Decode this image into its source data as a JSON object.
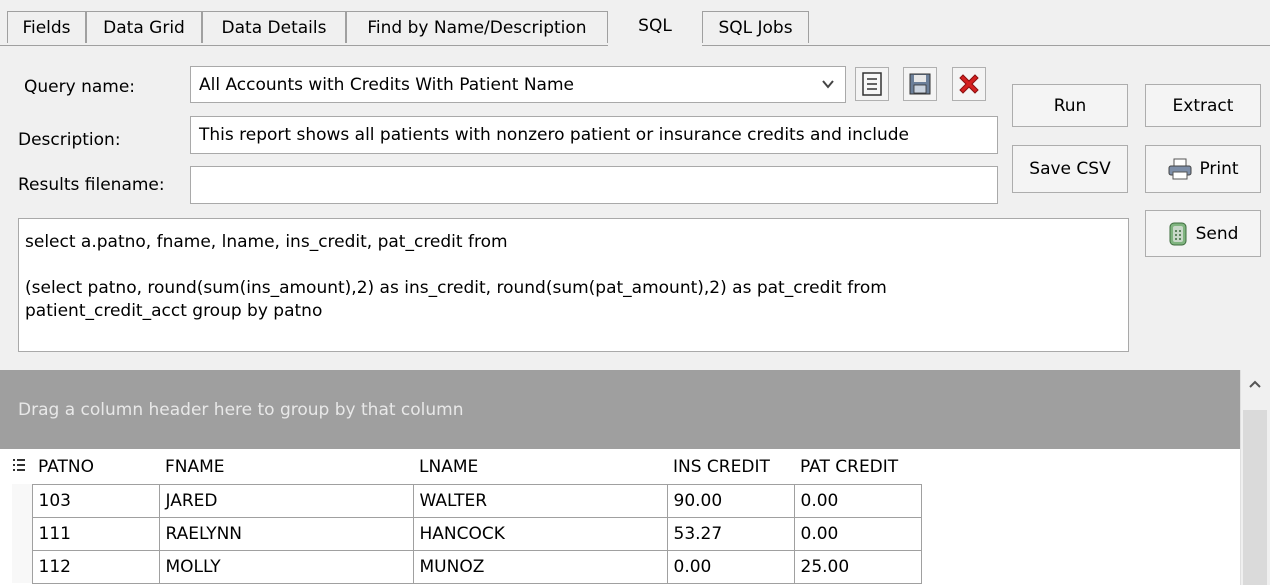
{
  "tabs": [
    {
      "label": "Fields"
    },
    {
      "label": "Data Grid"
    },
    {
      "label": "Data Details"
    },
    {
      "label": "Find by Name/Description"
    },
    {
      "label": "SQL"
    },
    {
      "label": "SQL Jobs"
    }
  ],
  "form": {
    "query_name_label": "Query name:",
    "query_name_value": "All Accounts with Credits With Patient Name",
    "description_label": "Description:",
    "description_value": "This report shows all patients with nonzero patient or insurance credits and include",
    "results_label": "Results filename:",
    "results_value": ""
  },
  "icons": {
    "new": "new-document-icon",
    "save": "save-icon",
    "delete": "delete-x-icon",
    "print": "printer-icon",
    "send": "send-icon"
  },
  "buttons": {
    "run": "Run",
    "extract": "Extract",
    "save_csv": "Save CSV",
    "print": "Print",
    "send": "Send"
  },
  "sql": {
    "line1": "select a.patno, fname, lname, ins_credit, pat_credit from",
    "line2": "(select patno, round(sum(ins_amount),2) as ins_credit, round(sum(pat_amount),2) as pat_credit from",
    "line3": "patient_credit_acct group by patno"
  },
  "grid": {
    "group_hint": "Drag a column header here to group by that column",
    "columns": [
      "PATNO",
      "FNAME",
      "LNAME",
      "INS CREDIT",
      "PAT CREDIT"
    ],
    "rows": [
      [
        "103",
        "JARED",
        "WALTER",
        "90.00",
        "0.00"
      ],
      [
        "111",
        "RAELYNN",
        "HANCOCK",
        "53.27",
        "0.00"
      ],
      [
        "112",
        "MOLLY",
        "MUNOZ",
        "0.00",
        "25.00"
      ]
    ]
  },
  "colors": {
    "group_bar": "#9f9f9f",
    "delete_red": "#d42020"
  }
}
